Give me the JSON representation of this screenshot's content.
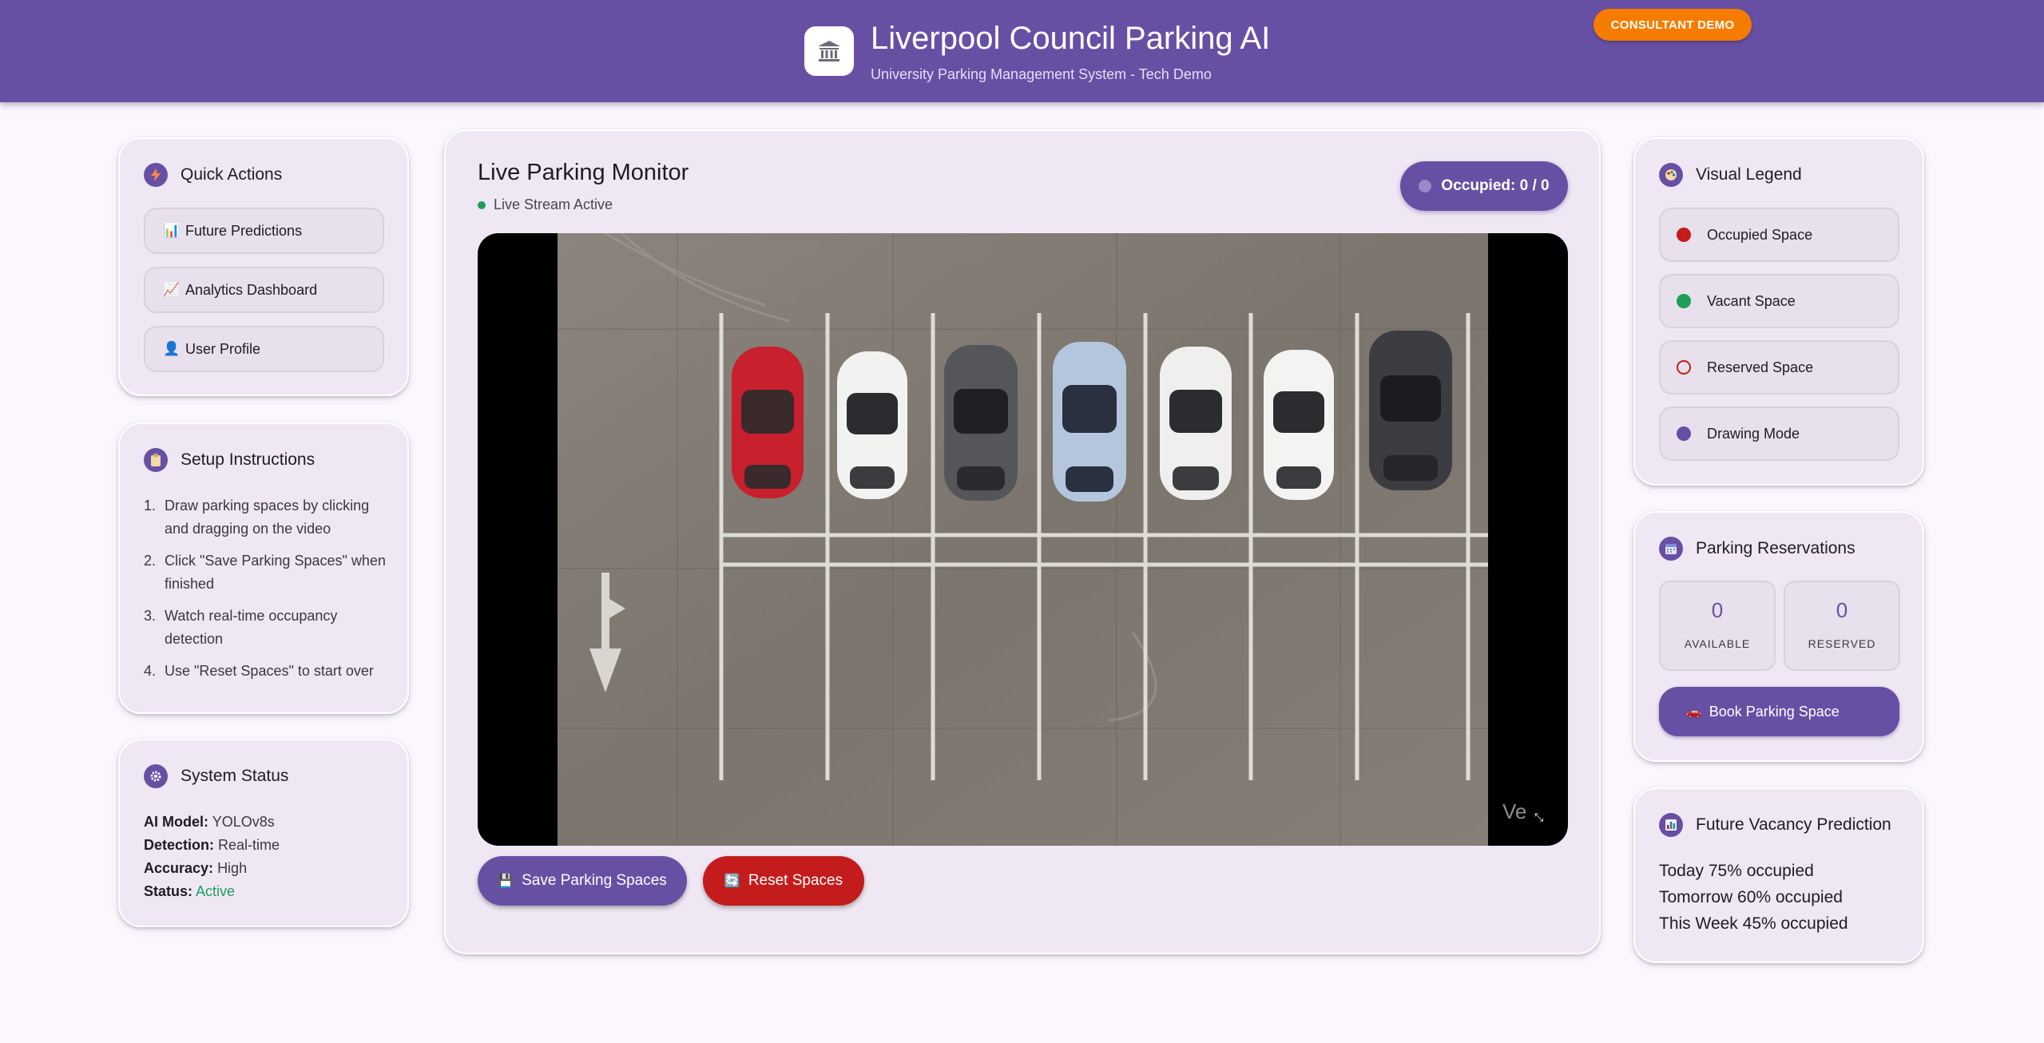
{
  "header": {
    "title": "Liverpool Council Parking AI",
    "subtitle": "University Parking Management System - Tech Demo",
    "logo_icon": "bank-building-icon",
    "badge": "CONSULTANT DEMO",
    "background": "#6750a4",
    "badge_color": "#f57c00"
  },
  "quick_actions": {
    "title": "Quick Actions",
    "icon": "lightning-icon",
    "items": [
      {
        "label": "Future Predictions",
        "icon": "bar-chart-icon"
      },
      {
        "label": "Analytics Dashboard",
        "icon": "trend-chart-icon"
      },
      {
        "label": "User Profile",
        "icon": "user-icon"
      }
    ]
  },
  "setup": {
    "title": "Setup Instructions",
    "icon": "clipboard-icon",
    "steps": [
      {
        "num": "1.",
        "text": "Draw parking spaces by clicking and dragging on the video"
      },
      {
        "num": "2.",
        "text": "Click \"Save Parking Spaces\" when finished"
      },
      {
        "num": "3.",
        "text": "Watch real-time occupancy detection"
      },
      {
        "num": "4.",
        "text": "Use \"Reset Spaces\" to start over"
      }
    ]
  },
  "system_status": {
    "title": "System Status",
    "icon": "gear-icon",
    "rows": [
      {
        "key": "AI Model:",
        "value": "YOLOv8s"
      },
      {
        "key": "Detection:",
        "value": "Real-time"
      },
      {
        "key": "Accuracy:",
        "value": "High"
      },
      {
        "key": "Status:",
        "value": "Active"
      }
    ],
    "active_color": "#1e9e5a"
  },
  "monitor": {
    "title": "Live Parking Monitor",
    "stream_status": "Live Stream Active",
    "occupied_badge": "Occupied: 0 / 0",
    "watermark": "Ve",
    "save_button": "Save Parking Spaces",
    "reset_button": "Reset Spaces",
    "save_icon": "floppy-disk-icon",
    "reset_icon": "refresh-icon"
  },
  "legend": {
    "title": "Visual Legend",
    "icon": "palette-icon",
    "items": [
      {
        "label": "Occupied Space",
        "color": "#c41c1c",
        "style": "filled"
      },
      {
        "label": "Vacant Space",
        "color": "#1e9e5a",
        "style": "filled"
      },
      {
        "label": "Reserved Space",
        "color": "#c41c1c",
        "style": "outline"
      },
      {
        "label": "Drawing Mode",
        "color": "#6750a4",
        "style": "filled"
      }
    ]
  },
  "reservations": {
    "title": "Parking Reservations",
    "icon": "calendar-icon",
    "available_count": "0",
    "available_label": "AVAILABLE",
    "reserved_count": "0",
    "reserved_label": "RESERVED",
    "book_button": "Book Parking Space",
    "book_icon": "car-icon"
  },
  "prediction": {
    "title": "Future Vacancy Prediction",
    "icon": "bar-chart-icon",
    "lines": [
      "Today 75% occupied",
      "Tomorrow 60% occupied",
      "This Week 45% occupied"
    ]
  }
}
